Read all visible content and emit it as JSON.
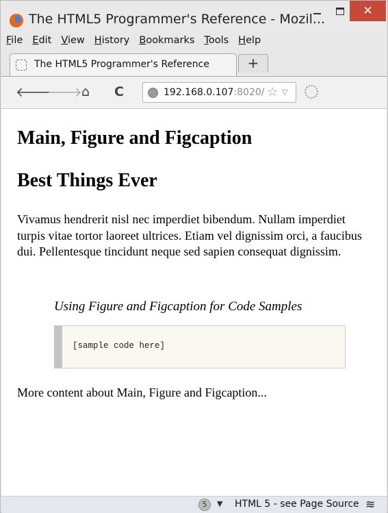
{
  "window": {
    "title": "The HTML5 Programmer's Reference - Mozil...",
    "close_glyph": "✕"
  },
  "menu": [
    "File",
    "Edit",
    "View",
    "History",
    "Bookmarks",
    "Tools",
    "Help"
  ],
  "tab": {
    "label": "The HTML5 Programmer's Reference",
    "new_tab_glyph": "+"
  },
  "nav": {
    "back_glyph": "🡐",
    "forward_glyph": "🡒",
    "home_glyph": "⌂",
    "reload_glyph": "C",
    "url_host": "192.168.0.107",
    "url_port": ":8020/",
    "star_glyph": "☆",
    "dropdown_glyph": "▽"
  },
  "page": {
    "heading1": "Main, Figure and Figcaption",
    "heading2": "Best Things Ever",
    "paragraph": "Vivamus hendrerit nisl nec imperdiet bibendum. Nullam imperdiet turpis vitae tortor laoreet ultrices. Etiam vel dignissim orci, a faucibus dui. Pellentesque tincidunt neque sed sapien consequat dignissim.",
    "figcaption": "Using Figure and Figcaption for Code Samples",
    "code": "[sample code here]",
    "paragraph2": "More content about Main, Figure and Figcaption..."
  },
  "status": {
    "count": "5",
    "arrow_glyph": "▼",
    "text": "HTML 5 - see Page Source",
    "icon_glyph": "≋"
  },
  "icons": {
    "app": "firefox-icon",
    "globe": "globe-icon",
    "throbber": "loading-icon",
    "layers": "layers-icon"
  }
}
